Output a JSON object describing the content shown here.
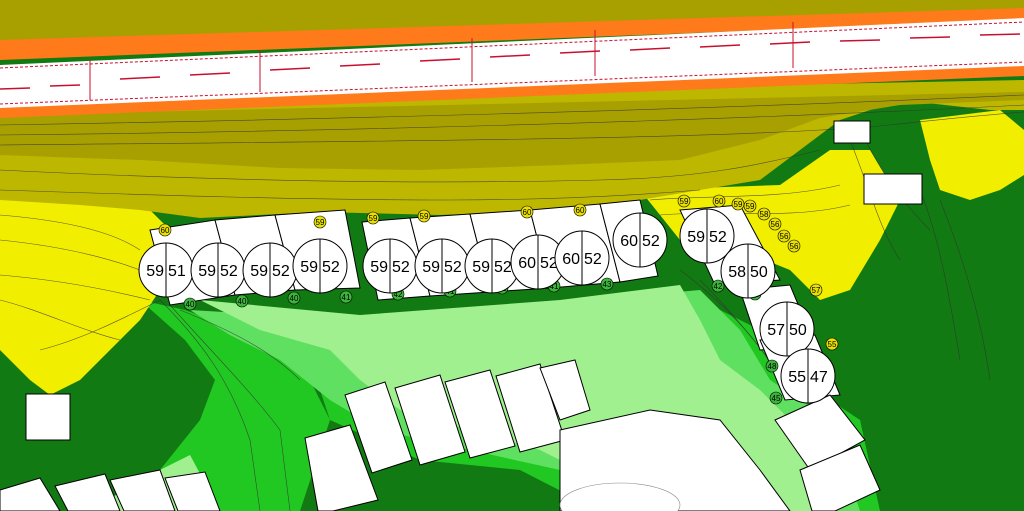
{
  "receiver_points": [
    {
      "id": "rp-1",
      "left": "59",
      "right": "51"
    },
    {
      "id": "rp-2",
      "left": "59",
      "right": "52"
    },
    {
      "id": "rp-3",
      "left": "59",
      "right": "52"
    },
    {
      "id": "rp-4",
      "left": "59",
      "right": "52"
    },
    {
      "id": "rp-5",
      "left": "59",
      "right": "52"
    },
    {
      "id": "rp-6",
      "left": "59",
      "right": "52"
    },
    {
      "id": "rp-7",
      "left": "59",
      "right": "52"
    },
    {
      "id": "rp-8",
      "left": "60",
      "right": "52"
    },
    {
      "id": "rp-9",
      "left": "60",
      "right": "52"
    },
    {
      "id": "rp-10",
      "left": "60",
      "right": "52"
    },
    {
      "id": "rp-11",
      "left": "59",
      "right": "52"
    },
    {
      "id": "rp-12",
      "left": "58",
      "right": "50"
    },
    {
      "id": "rp-13",
      "left": "57",
      "right": "50"
    },
    {
      "id": "rp-14",
      "left": "55",
      "right": "47"
    }
  ],
  "facade_points": [
    {
      "value": "60",
      "color": "#e8e000"
    },
    {
      "value": "59",
      "color": "#e8e000"
    },
    {
      "value": "59",
      "color": "#e8e000"
    },
    {
      "value": "59",
      "color": "#e8e000"
    },
    {
      "value": "60",
      "color": "#e8e000"
    },
    {
      "value": "60",
      "color": "#e8e000"
    },
    {
      "value": "59",
      "color": "#e8e000"
    },
    {
      "value": "60",
      "color": "#e8e000"
    },
    {
      "value": "59",
      "color": "#e8e000"
    },
    {
      "value": "59",
      "color": "#e8e000"
    },
    {
      "value": "58",
      "color": "#e8e000"
    },
    {
      "value": "56",
      "color": "#e8e000"
    },
    {
      "value": "56",
      "color": "#e8e000"
    },
    {
      "value": "56",
      "color": "#e8e000"
    },
    {
      "value": "57",
      "color": "#e8e000"
    },
    {
      "value": "55",
      "color": "#e8e000"
    },
    {
      "value": "40",
      "color": "#3cb43c"
    },
    {
      "value": "40",
      "color": "#3cb43c"
    },
    {
      "value": "40",
      "color": "#3cb43c"
    },
    {
      "value": "41",
      "color": "#3cb43c"
    },
    {
      "value": "42",
      "color": "#3cb43c"
    },
    {
      "value": "41",
      "color": "#3cb43c"
    },
    {
      "value": "41",
      "color": "#3cb43c"
    },
    {
      "value": "41",
      "color": "#3cb43c"
    },
    {
      "value": "43",
      "color": "#3cb43c"
    },
    {
      "value": "42",
      "color": "#3cb43c"
    },
    {
      "value": "43",
      "color": "#3cb43c"
    },
    {
      "value": "48",
      "color": "#3cb43c"
    },
    {
      "value": "45",
      "color": "#3cb43c"
    }
  ],
  "colors": {
    "road_surface": "#ffffff",
    "road_edge_red": "#c8102e",
    "band_orange": "#ff7a1a",
    "band_dark_olive": "#a8a000",
    "band_olive": "#bdb700",
    "band_yellow": "#f2ee00",
    "band_pale_green": "#a0f090",
    "band_light_green": "#60e060",
    "band_green": "#22c822",
    "band_dark_green": "#127a12",
    "building_fill": "#ffffff",
    "building_stroke": "#000000"
  }
}
